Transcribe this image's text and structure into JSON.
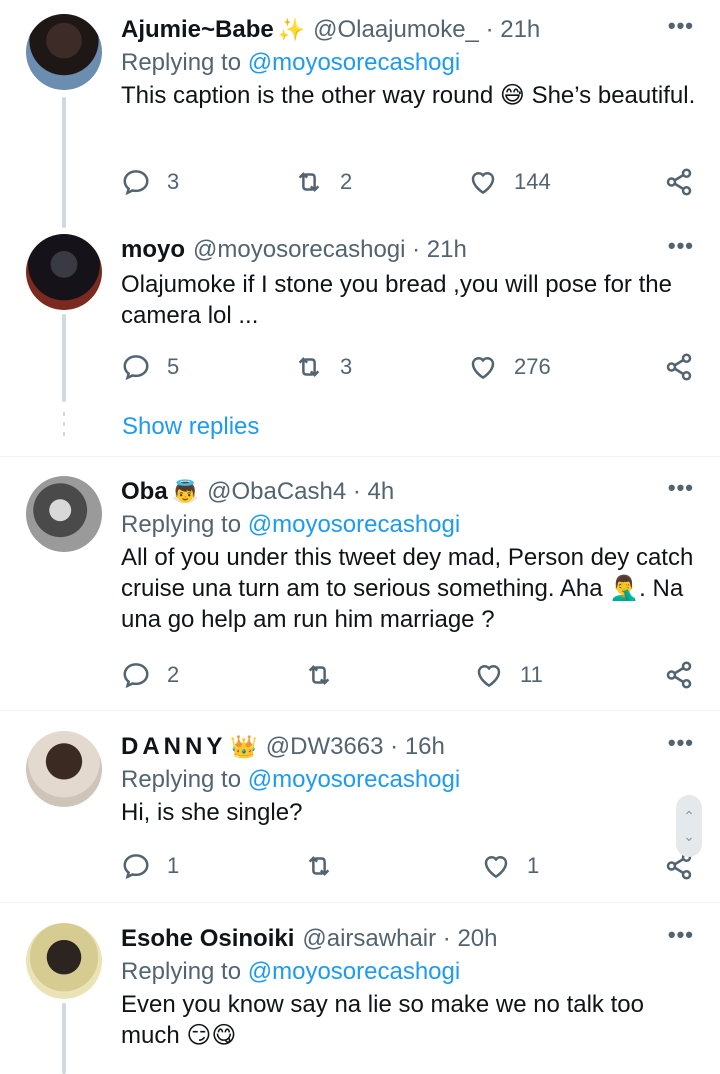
{
  "tweets": [
    {
      "name": "Ajumie~Babe",
      "name_emoji": "✨",
      "handle": "@Olaajumoke_ · 21h",
      "replying_prefix": "Replying to ",
      "replying_to": "@moyosorecashogi",
      "text_before": "This caption is the other way round",
      "emoji_1": "😅",
      "text_after": " She’s beautiful.",
      "replies": "3",
      "retweets": "2",
      "likes": "144",
      "avatar_color": "#5b4a45"
    },
    {
      "name": "moyo",
      "handle": "@moyosorecashogi · 21h",
      "text": "Olajumoke if I stone you bread ,you will pose for the camera lol ...",
      "replies": "5",
      "retweets": "3",
      "likes": "276",
      "avatar_color": "#2a2530"
    },
    {
      "name": "Oba",
      "name_emoji": "👼",
      "handle": "@ObaCash4 · 4h",
      "replying_prefix": "Replying to ",
      "replying_to": "@moyosorecashogi",
      "text_before": "All of you under this tweet dey mad, Person dey catch cruise una turn am to serious something. Aha ",
      "emoji_1": "🤦‍♂️",
      "text_after": ". Na una go help am run him marriage ?",
      "replies": "2",
      "retweets": "",
      "likes": "11",
      "avatar_color": "#8a8a8a"
    },
    {
      "name": "DANNY",
      "name_emoji": "👑",
      "handle": "@DW3663 · 16h",
      "replying_prefix": "Replying to ",
      "replying_to": "@moyosorecashogi",
      "text": "Hi, is she single?",
      "replies": "1",
      "retweets": "",
      "likes": "1",
      "avatar_color": "#c9b7a6"
    },
    {
      "name": "Esohe Osinoiki",
      "handle": "@airsawhair · 20h",
      "replying_prefix": "Replying to ",
      "replying_to": "@moyosorecashogi",
      "text_before": "Even you know say na lie so make we no talk too much ",
      "emoji_1": "😏",
      "emoji_2": "😋",
      "replies": "",
      "retweets": "",
      "likes": "",
      "avatar_color": "#d9cfa0"
    }
  ],
  "show_replies": "Show replies",
  "more_label": "•••",
  "icons": {
    "reply": "reply-icon",
    "retweet": "retweet-icon",
    "like": "heart-icon",
    "share": "share-icon",
    "more": "more-icon"
  },
  "colors": {
    "link": "#1d9bf0",
    "muted": "#536471",
    "text": "#0f1419"
  }
}
